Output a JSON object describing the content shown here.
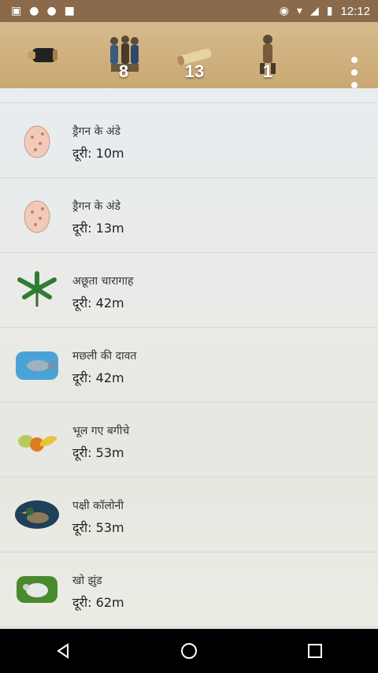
{
  "status_bar": {
    "time": "12:12",
    "icons": [
      "image-icon",
      "water-drop-icon",
      "water-drop-icon",
      "android-icon",
      "location-icon",
      "wifi-icon",
      "signal-icon",
      "battery-icon"
    ]
  },
  "toolbar": {
    "items": [
      {
        "icon": "spyglass-icon",
        "count": ""
      },
      {
        "icon": "warriors-icon",
        "count": "8"
      },
      {
        "icon": "scroll-icon",
        "count": "13"
      },
      {
        "icon": "soldier-icon",
        "count": "1"
      }
    ],
    "menu_icon": "more-vert-icon"
  },
  "list": {
    "items": [
      {
        "title": "ड्रैगन के अंडे",
        "distance": "दूरी: 10m",
        "icon": "dragon-egg-icon"
      },
      {
        "title": "ड्रैगन के अंडे",
        "distance": "दूरी: 13m",
        "icon": "dragon-egg-icon"
      },
      {
        "title": "अछूता चारागाह",
        "distance": "दूरी: 42m",
        "icon": "fern-plant-icon"
      },
      {
        "title": "मछली की दावत",
        "distance": "दूरी: 42m",
        "icon": "fish-icon"
      },
      {
        "title": "भूल गए बगीचे",
        "distance": "दूरी: 53m",
        "icon": "fruits-icon"
      },
      {
        "title": "पक्षी कॉलोनी",
        "distance": "दूरी: 53m",
        "icon": "duck-icon"
      },
      {
        "title": "खो झुंड",
        "distance": "दूरी: 62m",
        "icon": "sheep-icon"
      }
    ]
  },
  "nav": {
    "back": "back-icon",
    "home": "home-icon",
    "recents": "recents-icon"
  }
}
